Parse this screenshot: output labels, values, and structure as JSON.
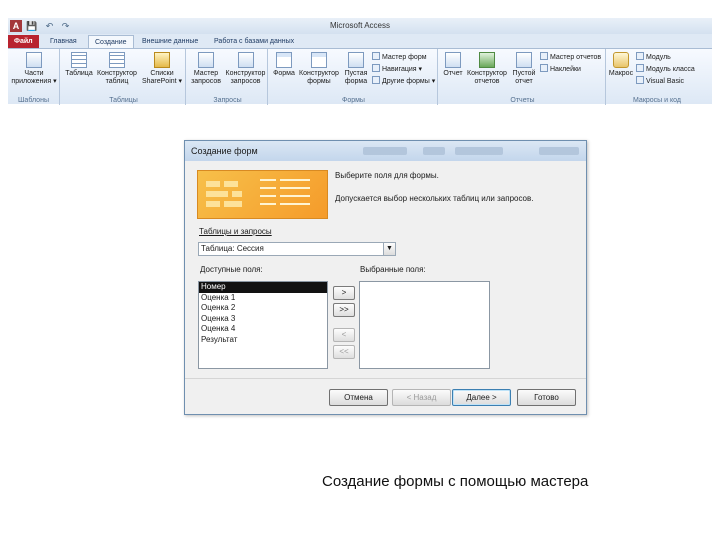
{
  "window": {
    "app_icon_letter": "A",
    "quick_access": "💾 ↶ ↷",
    "title": "Microsoft Access"
  },
  "ribbon": {
    "tabs": [
      {
        "label": "Файл"
      },
      {
        "label": "Главная"
      },
      {
        "label": "Создание"
      },
      {
        "label": "Внешние данные"
      },
      {
        "label": "Работа с базами данных"
      }
    ],
    "active_tab": "Создание",
    "groups": {
      "templates": {
        "label": "Шаблоны",
        "buttons": [
          "Части приложения ▾"
        ]
      },
      "tables": {
        "label": "Таблицы",
        "buttons": [
          "Таблица",
          "Конструктор таблиц",
          "Списки SharePoint ▾"
        ]
      },
      "queries": {
        "label": "Запросы",
        "buttons": [
          "Мастер запросов",
          "Конструктор запросов"
        ]
      },
      "forms": {
        "label": "Формы",
        "buttons": [
          "Форма",
          "Конструктор формы",
          "Пустая форма"
        ],
        "small": [
          "Мастер форм",
          "Навигация ▾",
          "Другие формы ▾"
        ]
      },
      "reports": {
        "label": "Отчеты",
        "buttons": [
          "Отчет",
          "Конструктор отчетов",
          "Пустой отчет"
        ],
        "small": [
          "Мастер отчетов",
          "Наклейки"
        ]
      },
      "macros": {
        "label": "Макросы и код",
        "buttons": [
          "Макрос"
        ],
        "small": [
          "Модуль",
          "Модуль класса",
          "Visual Basic"
        ]
      }
    }
  },
  "dialog": {
    "title": "Создание форм",
    "instruction": "Выберите поля для формы.",
    "hint": "Допускается выбор нескольких таблиц или запросов.",
    "tables_label": "Таблицы и запросы",
    "tables_value": "Таблица: Сессия",
    "available_label": "Доступные поля:",
    "available_fields": [
      "Номер",
      "Оценка 1",
      "Оценка 2",
      "Оценка 3",
      "Оценка 4",
      "Результат"
    ],
    "selected_index": 0,
    "selected_label": "Выбранные поля:",
    "selected_fields": [],
    "move_buttons": [
      ">",
      ">>",
      "<",
      "<<"
    ],
    "buttons": {
      "cancel": "Отмена",
      "back": "< Назад",
      "next": "Далее >",
      "finish": "Готово"
    }
  },
  "caption": "Создание формы с помощью мастера"
}
